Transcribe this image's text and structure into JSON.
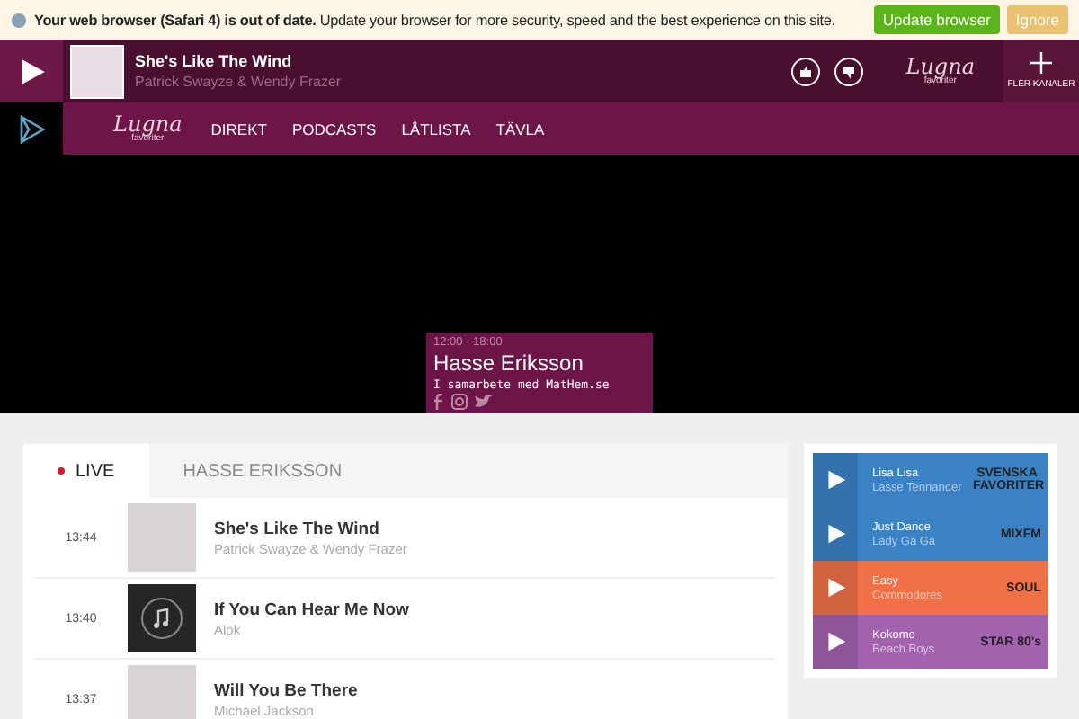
{
  "banner": {
    "message": "**Your web browser (Safari 4) is out of date.** Update your browser for more security, speed and the best experience on this site.",
    "buttons": [
      {
        "label": "Update browser",
        "kind": "primary"
      },
      {
        "label": "Ignore",
        "kind": "secondary"
      }
    ]
  },
  "player": {
    "title": "She's Like The Wind",
    "artist": "Patrick Swayze & Wendy Frazer",
    "logo": {
      "name": "Lugna",
      "sub": "favoriter"
    },
    "more_channels": "FLER KANALER"
  },
  "nav": {
    "logo": {
      "name": "Lugna",
      "sub": "favoriter"
    },
    "items": [
      {
        "label": "DIREKT"
      },
      {
        "label": "PODCASTS"
      },
      {
        "label": "LÅTLISTA"
      },
      {
        "label": "TÄVLA"
      }
    ]
  },
  "show": {
    "time": "12:00 - 18:00",
    "host": "Hasse Eriksson",
    "tagline": "I samarbete med MatHem.se"
  },
  "tabs": [
    {
      "label": "LIVE",
      "selected": true,
      "live": true
    },
    {
      "label": "HASSE ERIKSSON",
      "selected": false,
      "live": false
    }
  ],
  "playlist": [
    {
      "time": "13:44",
      "title": "She's Like The Wind",
      "artist": "Patrick Swayze & Wendy Frazer",
      "kind": "photo"
    },
    {
      "time": "13:40",
      "title": "If You Can Hear Me Now",
      "artist": "Alok",
      "kind": "note"
    },
    {
      "time": "13:37",
      "title": "Will You Be There",
      "artist": "Michael Jackson",
      "kind": "photo"
    }
  ],
  "stations": [
    {
      "title": "Lisa Lisa",
      "artist": "Lasse Tennander",
      "logo": "SVENSKA FAVORITER",
      "color": "#3b82c4"
    },
    {
      "title": "Just Dance",
      "artist": "Lady Ga Ga",
      "logo": "MIXFM",
      "color": "#3b82c4"
    },
    {
      "title": "Easy",
      "artist": "Commodores",
      "logo": "SOUL",
      "color": "#f07148"
    },
    {
      "title": "Kokomo",
      "artist": "Beach Boys",
      "logo": "STAR 80's",
      "color": "#a262ae"
    }
  ]
}
